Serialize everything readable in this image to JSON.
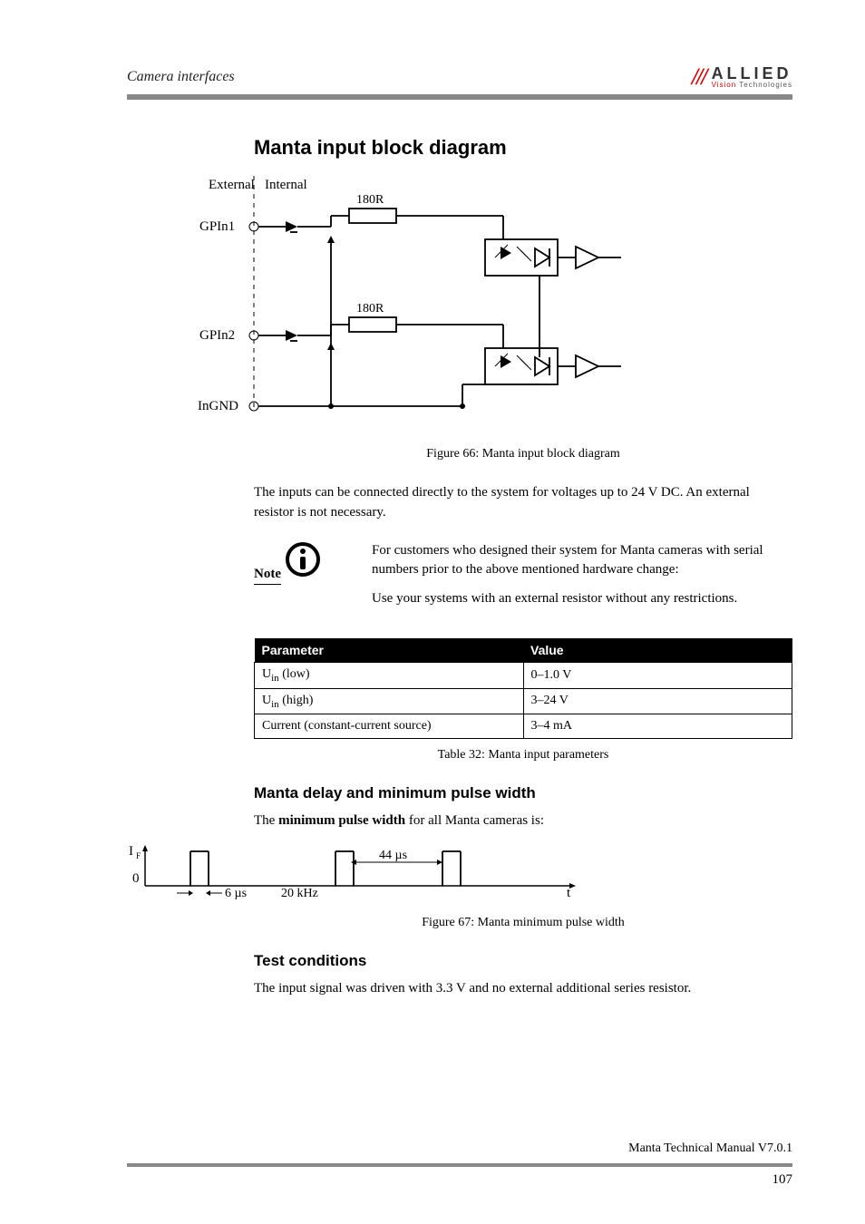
{
  "header": {
    "breadcrumb": "Camera interfaces",
    "logo_slashes": "///",
    "logo_main": "ALLIED",
    "logo_sub_red": "Vision",
    "logo_sub_rest": " Technologies"
  },
  "section_title": "Manta input block diagram",
  "diagram": {
    "external_label": "External",
    "internal_label": "Internal",
    "gpin1": "GPIn1",
    "gpin2": "GPIn2",
    "ingnd": "InGND",
    "r_label": "180R"
  },
  "fig66_caption": "Figure 66: Manta input block diagram",
  "intro_p": "The inputs can be connected directly to the system for voltages up to 24 V DC. An external resistor is not necessary.",
  "note": {
    "label": "Note",
    "p1": "For customers who designed their system for Manta cameras with serial numbers prior to the above mentioned hardware change:",
    "p2": "Use your systems with an external resistor without any restrictions."
  },
  "table": {
    "headers": {
      "param": "Parameter",
      "value": "Value"
    },
    "rows": [
      {
        "param_pre": "U",
        "param_sub": "in",
        "param_post": " (low)",
        "value": "0–1.0 V"
      },
      {
        "param_pre": "U",
        "param_sub": "in",
        "param_post": " (high)",
        "value": "3–24 V"
      },
      {
        "param_plain": "Current (constant-current source)",
        "value": "3–4 mA"
      }
    ]
  },
  "table32_caption": "Table 32: Manta input parameters",
  "delay_heading": "Manta delay and minimum pulse width",
  "delay_intro_pre": "The ",
  "delay_intro_bold": "minimum pulse width",
  "delay_intro_post": " for all Manta cameras is:",
  "pulse": {
    "y_label": "I",
    "y_sub": "F",
    "zero": "0",
    "d1": "6 µs",
    "freq": "20 kHz",
    "d2": "44 µs",
    "t": "t"
  },
  "fig67_caption": "Figure 67: Manta minimum pulse width",
  "test_heading": "Test conditions",
  "test_p": "The input signal was driven with 3.3 V and no external additional series resistor.",
  "footer": {
    "manual": "Manta Technical Manual V7.0.1",
    "page": "107"
  }
}
